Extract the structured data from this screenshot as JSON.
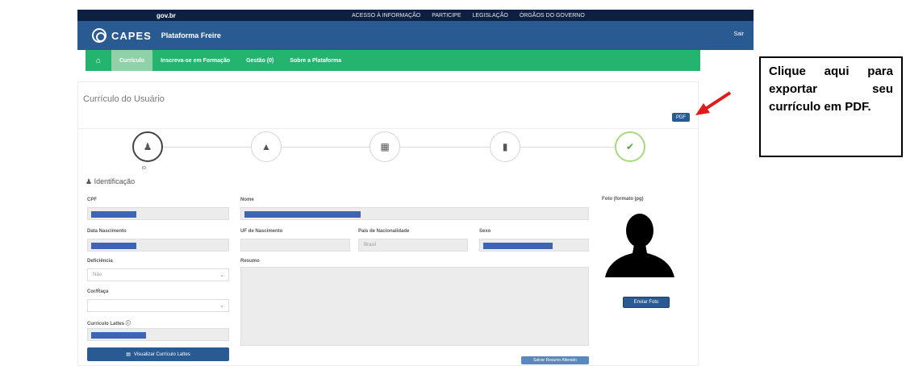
{
  "govbar": {
    "logo": "gov.br",
    "links": [
      "",
      "ACESSO À INFORMAÇÃO",
      "PARTICIPE",
      "LEGISLAÇÃO",
      "ÓRGÃOS DO GOVERNO"
    ]
  },
  "header": {
    "brand": "CAPES",
    "product": "Plataforma Freire",
    "user": "",
    "logout": "Sair"
  },
  "nav": {
    "items": [
      "Currículo",
      "Inscreva-se em Formação",
      "Gestão (0)",
      "Sobre a Plataforma"
    ]
  },
  "card": {
    "title": "Currículo do Usuário",
    "last_access": "",
    "pdf_label": "PDF"
  },
  "steps": {
    "caption": "ID"
  },
  "section": {
    "title": "Identificação"
  },
  "fields": {
    "cpf": "CPF",
    "nome": "Nome",
    "data_nascimento": "Data Nascimento",
    "uf_nascimento": "UF de Nascimento",
    "pais_nacionalidade": "País de Nacionalidade",
    "pais_value": "Brasil",
    "sexo": "Sexo",
    "deficiencia": "Deficiência",
    "deficiencia_value": "Não",
    "cor_raca": "Cor/Raça",
    "curriculo_lattes": "Currículo Lattes",
    "resumo": "Resumo"
  },
  "buttons": {
    "lattes": "Visualizar Currículo Lattes",
    "save_resume": "Salvar Resumo Alterado",
    "send_photo": "Enviar Foto"
  },
  "resume": {
    "count": "",
    "remaining": ""
  },
  "photo": {
    "label": "Foto (formato jpg)",
    "note": ""
  },
  "callout": {
    "text": "Clique aqui para exportar seu currículo em PDF."
  }
}
